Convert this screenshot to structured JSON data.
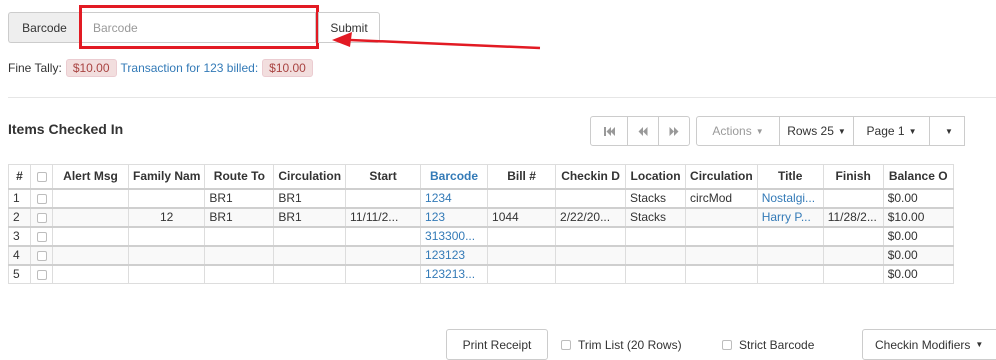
{
  "barcode_form": {
    "addon_label": "Barcode",
    "input_placeholder": "Barcode",
    "input_value": "",
    "submit_label": "Submit",
    "highlight_color": "#e21a23"
  },
  "fine_tally": {
    "label": "Fine Tally:",
    "amount": "$10.00",
    "transaction_text": "Transaction for 123 billed:",
    "billed_amount": "$10.00"
  },
  "section_title": "Items Checked In",
  "toolbar": {
    "first_page_icon": "first-page-icon",
    "prev_page_icon": "previous-page-icon",
    "next_page_icon": "next-page-icon",
    "actions_label": "Actions",
    "rows_label": "Rows 25",
    "page_label": "Page 1",
    "caret": "▾"
  },
  "table": {
    "columns": [
      "#",
      "",
      "Alert Msg",
      "Family Nam",
      "Route To",
      "Circulation",
      "Start",
      "Barcode",
      "Bill #",
      "Checkin D",
      "Location",
      "Circulation",
      "Title",
      "Finish",
      "Balance O"
    ],
    "rows": [
      [
        "1",
        "",
        "",
        "",
        "BR1",
        "BR1",
        "",
        "1234",
        "",
        "",
        "Stacks",
        "circMod",
        "Nostalgi...",
        "",
        "$0.00"
      ],
      [
        "2",
        "",
        "",
        "12",
        "BR1",
        "BR1",
        "11/11/2...",
        "123",
        "1044",
        "2/22/20...",
        "Stacks",
        "",
        "Harry P...",
        "11/28/2...",
        "$10.00"
      ],
      [
        "3",
        "",
        "",
        "",
        "",
        "",
        "",
        "313300...",
        "",
        "",
        "",
        "",
        "",
        "",
        "$0.00"
      ],
      [
        "4",
        "",
        "",
        "",
        "",
        "",
        "",
        "123123",
        "",
        "",
        "",
        "",
        "",
        "",
        "$0.00"
      ],
      [
        "5",
        "",
        "",
        "",
        "",
        "",
        "",
        "123213...",
        "",
        "",
        "",
        "",
        "",
        "",
        "$0.00"
      ]
    ]
  },
  "bottom": {
    "print_receipt_label": "Print Receipt",
    "trim_list_label": "Trim List (20 Rows)",
    "strict_barcode_label": "Strict Barcode",
    "checkin_modifiers_label": "Checkin Modifiers"
  },
  "colors": {
    "link": "#337ab7",
    "danger_text": "#a94442",
    "danger_bg": "#f2dede"
  }
}
